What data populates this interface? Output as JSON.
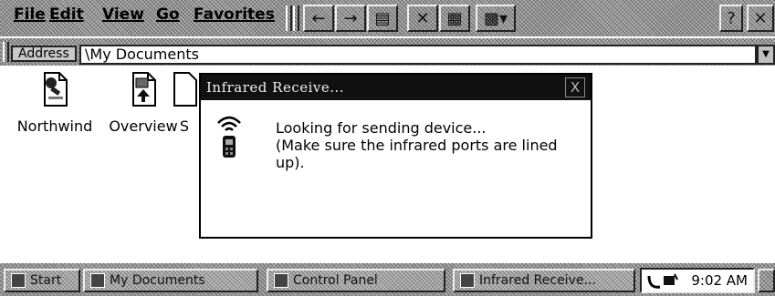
{
  "menubar": {
    "items": [
      "File",
      "Edit",
      "View",
      "Go",
      "Favorites"
    ]
  },
  "toolbar": {
    "buttons": [
      "back-icon",
      "forward-icon",
      "up-icon",
      "delete-icon",
      "properties-icon",
      "views-icon"
    ],
    "help_icon": "help-icon",
    "close_icon": "close-icon"
  },
  "address": {
    "label": "Address",
    "value": "\\My Documents"
  },
  "files": [
    {
      "label": "Northwind",
      "icon": "database-icon"
    },
    {
      "label": "Overview",
      "icon": "presentation-icon"
    },
    {
      "label": "S",
      "icon": "file-icon"
    }
  ],
  "dialog": {
    "title": "Infrared Receive...",
    "line1": "Looking for sending device...",
    "line2": "(Make sure the infrared ports are lined up).",
    "icon": "infrared-icon",
    "close_label": "X"
  },
  "taskbar": {
    "start_label": "Start",
    "tasks": [
      "My Documents",
      "Control Panel",
      "Infrared Receive..."
    ],
    "clock": "9:02 AM"
  },
  "colors": {
    "titlebar": "#111111",
    "background": "#ffffff",
    "chrome": "#9a9a9a"
  }
}
